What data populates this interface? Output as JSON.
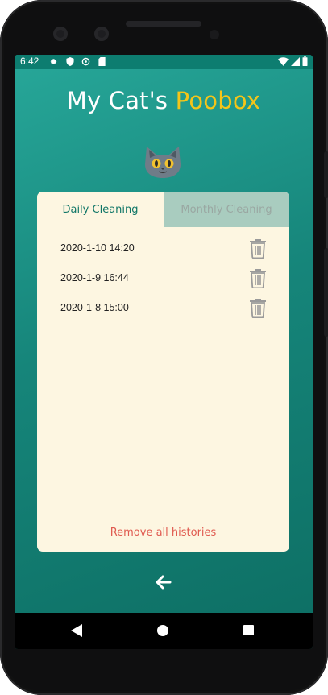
{
  "status_bar": {
    "time": "6:42",
    "left_icons": [
      "gear-icon",
      "shield-icon",
      "data-saver-icon",
      "sd-card-icon"
    ],
    "right_icons": [
      "wifi-icon",
      "signal-icon",
      "battery-icon"
    ]
  },
  "header": {
    "title_part1": "My Cat's ",
    "title_part2": "Poobox"
  },
  "tabs": [
    {
      "label": "Daily Cleaning",
      "active": true
    },
    {
      "label": "Monthly Cleaning",
      "active": false
    }
  ],
  "histories": [
    {
      "date": "2020-1-10 14:20"
    },
    {
      "date": "2020-1-9 16:44"
    },
    {
      "date": "2020-1-8 15:00"
    }
  ],
  "remove_all_label": "Remove all histories",
  "colors": {
    "accent_yellow": "#f5c518",
    "teal": "#0e7566",
    "card_bg": "#fdf6e1",
    "remove_red": "#e05a50"
  }
}
